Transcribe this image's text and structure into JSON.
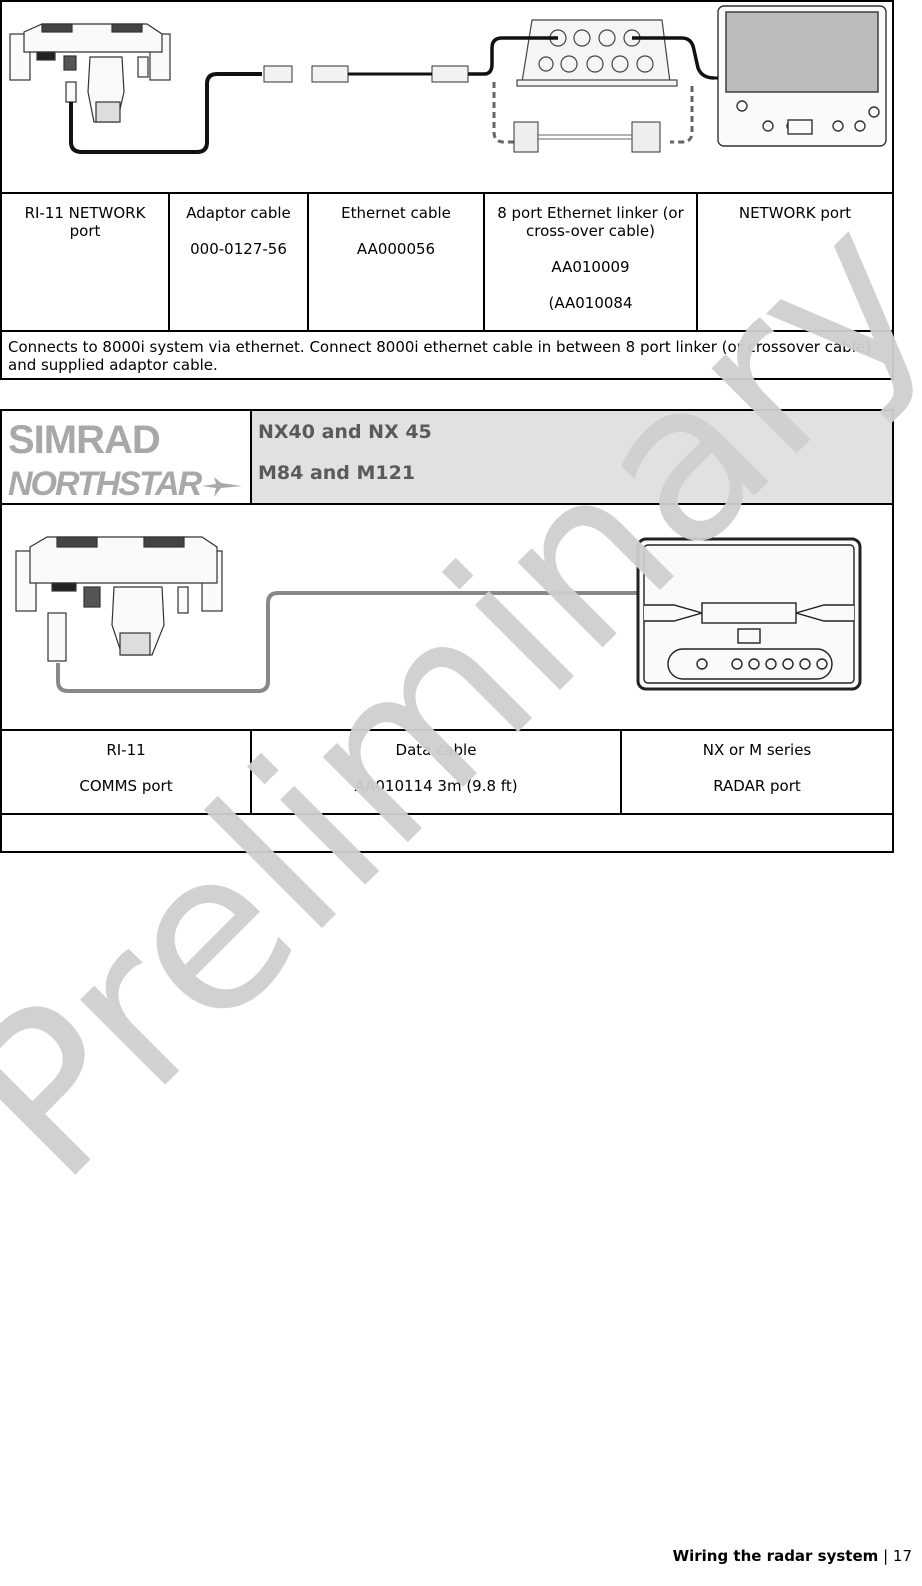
{
  "table1": {
    "diagram": {
      "description": "RI-11 unit connected via adaptor cable and ethernet cable to 8 port ethernet linker (or crossover cable) and display NETWORK port"
    },
    "columns": [
      {
        "lines": [
          "RI-11 NETWORK port"
        ]
      },
      {
        "lines": [
          "Adaptor cable",
          "000-0127-56"
        ]
      },
      {
        "lines": [
          "Ethernet cable",
          "AA000056"
        ]
      },
      {
        "lines": [
          "8 port Ethernet linker (or cross-over cable)",
          "AA010009",
          "(AA010084"
        ]
      },
      {
        "lines": [
          "NETWORK port"
        ]
      }
    ],
    "note": "Connects to 8000i system via ethernet. Connect 8000i ethernet cable in between 8 port linker (or crossover cable) and supplied adaptor cable."
  },
  "table2": {
    "logo": {
      "line1": "SIMRAD",
      "line2": "NORTHSTAR"
    },
    "titles": [
      "NX40 and NX 45",
      "M84 and M121"
    ],
    "diagram": {
      "description": "RI-11 COMMS port connected by data cable to NX or M series display RADAR port"
    },
    "columns": [
      {
        "lines": [
          "RI-11",
          "COMMS port"
        ]
      },
      {
        "lines": [
          "Data cable",
          "AA010114 3m (9.8 ft)"
        ]
      },
      {
        "lines": [
          "NX or M series",
          "RADAR port"
        ]
      }
    ],
    "note": ""
  },
  "watermark": "Preliminary",
  "footer": {
    "section": "Wiring the radar system",
    "separator": "|",
    "page": "17"
  },
  "colors": {
    "header_bg": "#e1e1e1",
    "title_text": "#5a5a5a",
    "watermark": "#cfcfcf",
    "logo": "#a8a8a8"
  }
}
